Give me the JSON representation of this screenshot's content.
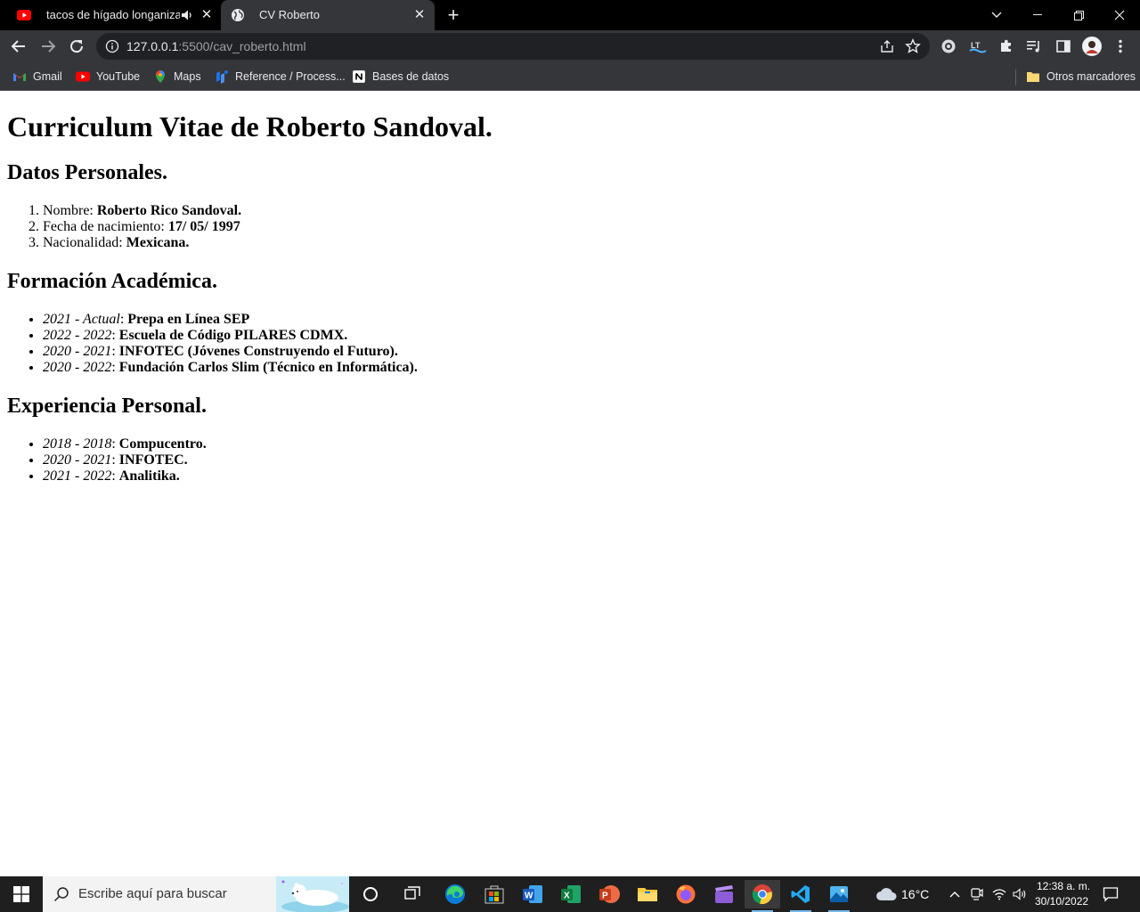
{
  "browser": {
    "tabs": [
      {
        "title": "tacos de hígado longaniza y",
        "favicon": "youtube-icon",
        "audio": "speaker-icon"
      },
      {
        "title": "CV Roberto",
        "favicon": "globe-icon",
        "active": true
      }
    ],
    "address": {
      "host": "127.0.0.1",
      "path": ":5500/cav_roberto.html"
    },
    "bookmarks": [
      {
        "label": "Gmail",
        "icon": "gmail-icon"
      },
      {
        "label": "YouTube",
        "icon": "youtube-icon"
      },
      {
        "label": "Maps",
        "icon": "maps-icon"
      },
      {
        "label": "Reference / Process...",
        "icon": "bookmark-icon"
      },
      {
        "label": "Bases de datos",
        "icon": "notion-icon"
      }
    ],
    "other_bookmarks": "Otros marcadores"
  },
  "page": {
    "title": "Curriculum Vitae de Roberto Sandoval.",
    "sections": {
      "personal": {
        "heading": "Datos Personales.",
        "items": [
          {
            "label": "Nombre: ",
            "value": "Roberto Rico Sandoval."
          },
          {
            "label": "Fecha de nacimiento: ",
            "value": "17/ 05/ 1997"
          },
          {
            "label": "Nacionalidad: ",
            "value": "Mexicana."
          }
        ]
      },
      "education": {
        "heading": "Formación Académica.",
        "items": [
          {
            "period": "2021 - Actual",
            "sep": ": ",
            "value": "Prepa en Línea SEP"
          },
          {
            "period": "2022 - 2022",
            "sep": ": ",
            "value": "Escuela de Código PILARES CDMX."
          },
          {
            "period": "2020 - 2021",
            "sep": ": ",
            "value": "INFOTEC (Jóvenes Construyendo el Futuro)."
          },
          {
            "period": "2020 - 2022",
            "sep": ": ",
            "value": "Fundación Carlos Slim (Técnico en Informática)."
          }
        ]
      },
      "experience": {
        "heading": "Experiencia Personal.",
        "items": [
          {
            "period": "2018 - 2018",
            "sep": ": ",
            "value": "Compucentro."
          },
          {
            "period": "2020 - 2021",
            "sep": ": ",
            "value": "INFOTEC."
          },
          {
            "period": "2021 - 2022",
            "sep": ": ",
            "value": "Analitika."
          }
        ]
      }
    }
  },
  "taskbar": {
    "search_placeholder": "Escribe aquí para buscar",
    "weather": "16°C",
    "time": "12:38 a. m.",
    "date": "30/10/2022"
  }
}
